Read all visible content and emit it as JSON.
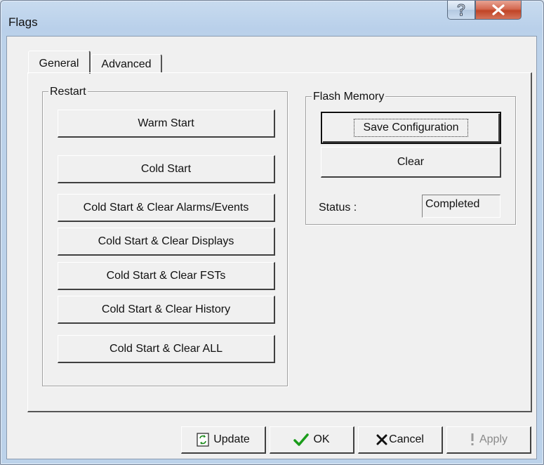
{
  "window": {
    "title": "Flags"
  },
  "tabs": [
    {
      "label": "General",
      "active": true
    },
    {
      "label": "Advanced",
      "active": false
    }
  ],
  "restart": {
    "label": "Restart",
    "buttons": [
      {
        "label": "Warm Start"
      },
      {
        "label": "Cold Start"
      },
      {
        "label": "Cold Start & Clear Alarms/Events"
      },
      {
        "label": "Cold Start & Clear Displays"
      },
      {
        "label": "Cold Start & Clear FSTs"
      },
      {
        "label": "Cold Start & Clear History"
      },
      {
        "label": "Cold Start & Clear ALL"
      }
    ]
  },
  "flash": {
    "label": "Flash Memory",
    "save_label": "Save Configuration",
    "clear_label": "Clear",
    "status_label": "Status :",
    "status_value": "Completed"
  },
  "footer": {
    "update_label": "Update",
    "ok_label": "OK",
    "cancel_label": "Cancel",
    "apply_label": "Apply"
  },
  "colors": {
    "ok_check": "#1a9c1a",
    "cancel_x": "#111111",
    "close_bg": "#c9452a"
  }
}
